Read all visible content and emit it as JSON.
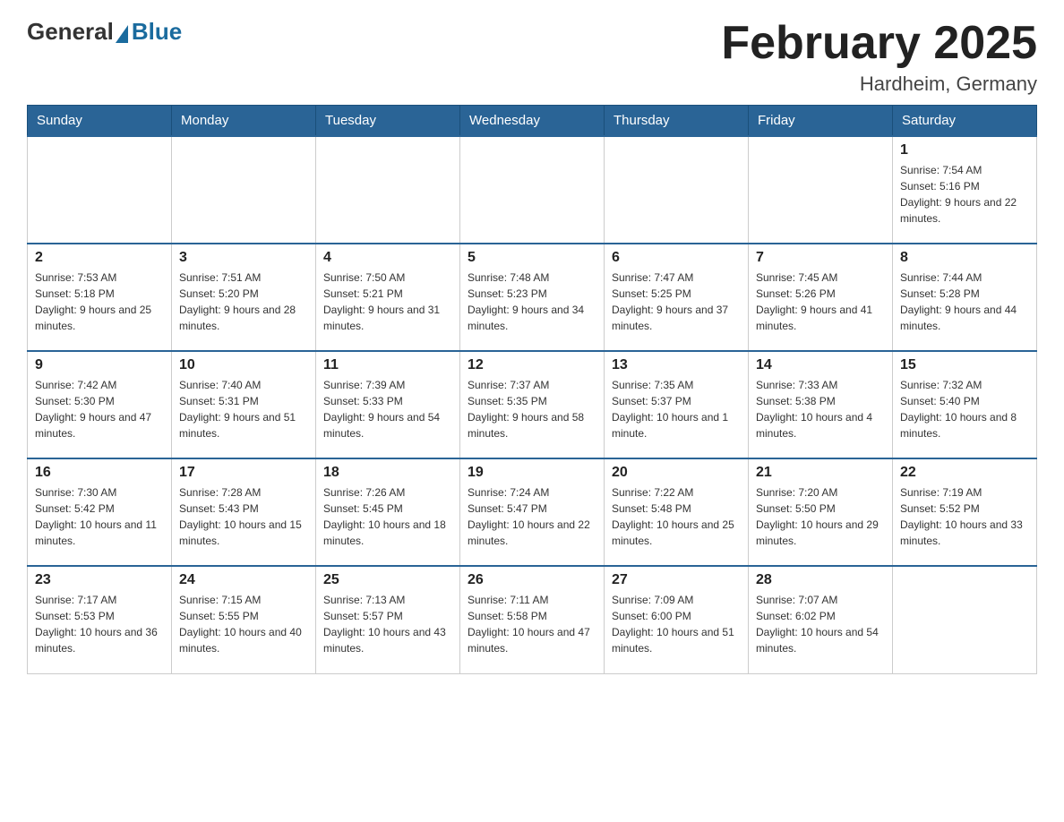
{
  "logo": {
    "general": "General",
    "blue": "Blue"
  },
  "title": "February 2025",
  "subtitle": "Hardheim, Germany",
  "days_header": [
    "Sunday",
    "Monday",
    "Tuesday",
    "Wednesday",
    "Thursday",
    "Friday",
    "Saturday"
  ],
  "weeks": [
    [
      {
        "day": "",
        "info": ""
      },
      {
        "day": "",
        "info": ""
      },
      {
        "day": "",
        "info": ""
      },
      {
        "day": "",
        "info": ""
      },
      {
        "day": "",
        "info": ""
      },
      {
        "day": "",
        "info": ""
      },
      {
        "day": "1",
        "info": "Sunrise: 7:54 AM\nSunset: 5:16 PM\nDaylight: 9 hours and 22 minutes."
      }
    ],
    [
      {
        "day": "2",
        "info": "Sunrise: 7:53 AM\nSunset: 5:18 PM\nDaylight: 9 hours and 25 minutes."
      },
      {
        "day": "3",
        "info": "Sunrise: 7:51 AM\nSunset: 5:20 PM\nDaylight: 9 hours and 28 minutes."
      },
      {
        "day": "4",
        "info": "Sunrise: 7:50 AM\nSunset: 5:21 PM\nDaylight: 9 hours and 31 minutes."
      },
      {
        "day": "5",
        "info": "Sunrise: 7:48 AM\nSunset: 5:23 PM\nDaylight: 9 hours and 34 minutes."
      },
      {
        "day": "6",
        "info": "Sunrise: 7:47 AM\nSunset: 5:25 PM\nDaylight: 9 hours and 37 minutes."
      },
      {
        "day": "7",
        "info": "Sunrise: 7:45 AM\nSunset: 5:26 PM\nDaylight: 9 hours and 41 minutes."
      },
      {
        "day": "8",
        "info": "Sunrise: 7:44 AM\nSunset: 5:28 PM\nDaylight: 9 hours and 44 minutes."
      }
    ],
    [
      {
        "day": "9",
        "info": "Sunrise: 7:42 AM\nSunset: 5:30 PM\nDaylight: 9 hours and 47 minutes."
      },
      {
        "day": "10",
        "info": "Sunrise: 7:40 AM\nSunset: 5:31 PM\nDaylight: 9 hours and 51 minutes."
      },
      {
        "day": "11",
        "info": "Sunrise: 7:39 AM\nSunset: 5:33 PM\nDaylight: 9 hours and 54 minutes."
      },
      {
        "day": "12",
        "info": "Sunrise: 7:37 AM\nSunset: 5:35 PM\nDaylight: 9 hours and 58 minutes."
      },
      {
        "day": "13",
        "info": "Sunrise: 7:35 AM\nSunset: 5:37 PM\nDaylight: 10 hours and 1 minute."
      },
      {
        "day": "14",
        "info": "Sunrise: 7:33 AM\nSunset: 5:38 PM\nDaylight: 10 hours and 4 minutes."
      },
      {
        "day": "15",
        "info": "Sunrise: 7:32 AM\nSunset: 5:40 PM\nDaylight: 10 hours and 8 minutes."
      }
    ],
    [
      {
        "day": "16",
        "info": "Sunrise: 7:30 AM\nSunset: 5:42 PM\nDaylight: 10 hours and 11 minutes."
      },
      {
        "day": "17",
        "info": "Sunrise: 7:28 AM\nSunset: 5:43 PM\nDaylight: 10 hours and 15 minutes."
      },
      {
        "day": "18",
        "info": "Sunrise: 7:26 AM\nSunset: 5:45 PM\nDaylight: 10 hours and 18 minutes."
      },
      {
        "day": "19",
        "info": "Sunrise: 7:24 AM\nSunset: 5:47 PM\nDaylight: 10 hours and 22 minutes."
      },
      {
        "day": "20",
        "info": "Sunrise: 7:22 AM\nSunset: 5:48 PM\nDaylight: 10 hours and 25 minutes."
      },
      {
        "day": "21",
        "info": "Sunrise: 7:20 AM\nSunset: 5:50 PM\nDaylight: 10 hours and 29 minutes."
      },
      {
        "day": "22",
        "info": "Sunrise: 7:19 AM\nSunset: 5:52 PM\nDaylight: 10 hours and 33 minutes."
      }
    ],
    [
      {
        "day": "23",
        "info": "Sunrise: 7:17 AM\nSunset: 5:53 PM\nDaylight: 10 hours and 36 minutes."
      },
      {
        "day": "24",
        "info": "Sunrise: 7:15 AM\nSunset: 5:55 PM\nDaylight: 10 hours and 40 minutes."
      },
      {
        "day": "25",
        "info": "Sunrise: 7:13 AM\nSunset: 5:57 PM\nDaylight: 10 hours and 43 minutes."
      },
      {
        "day": "26",
        "info": "Sunrise: 7:11 AM\nSunset: 5:58 PM\nDaylight: 10 hours and 47 minutes."
      },
      {
        "day": "27",
        "info": "Sunrise: 7:09 AM\nSunset: 6:00 PM\nDaylight: 10 hours and 51 minutes."
      },
      {
        "day": "28",
        "info": "Sunrise: 7:07 AM\nSunset: 6:02 PM\nDaylight: 10 hours and 54 minutes."
      },
      {
        "day": "",
        "info": ""
      }
    ]
  ]
}
